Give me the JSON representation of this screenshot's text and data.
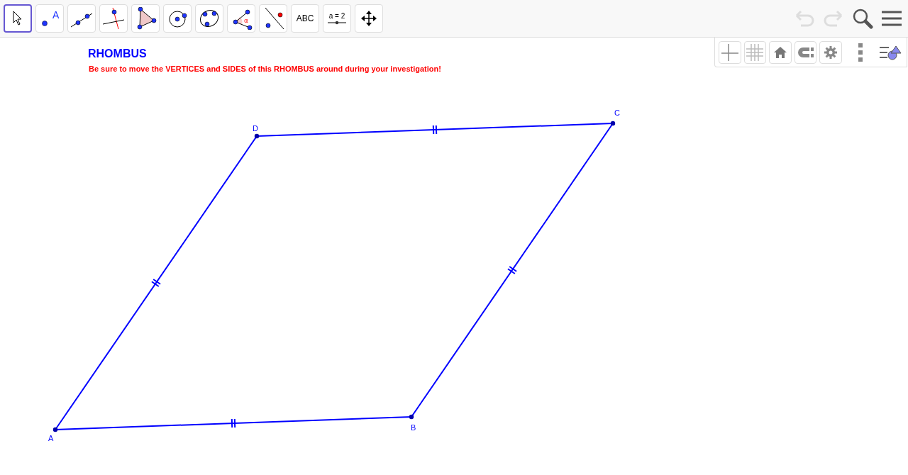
{
  "toolbar": {
    "tools": [
      {
        "kind": "move",
        "selected": true
      },
      {
        "kind": "point",
        "label": "A",
        "selected": false
      },
      {
        "kind": "line",
        "selected": false
      },
      {
        "kind": "perpendicular",
        "selected": false
      },
      {
        "kind": "polygon",
        "selected": false
      },
      {
        "kind": "circle",
        "selected": false
      },
      {
        "kind": "conic",
        "selected": false
      },
      {
        "kind": "angle",
        "label": "α",
        "selected": false
      },
      {
        "kind": "reflect",
        "selected": false
      },
      {
        "kind": "text",
        "label": "ABC",
        "selected": false
      },
      {
        "kind": "slider",
        "label": "a = 2",
        "selected": false
      },
      {
        "kind": "pan",
        "selected": false
      }
    ],
    "undo": {
      "disabled": true
    },
    "redo": {
      "disabled": true
    }
  },
  "style_bar": {
    "buttons": [
      {
        "kind": "axes",
        "selected": false
      },
      {
        "kind": "grid",
        "selected": false
      },
      {
        "kind": "home",
        "selected": false
      },
      {
        "kind": "snap",
        "selected": false
      },
      {
        "kind": "settings",
        "selected": false
      }
    ]
  },
  "canvas": {
    "title": "RHOMBUS",
    "instruction": "Be sure to move the VERTICES and SIDES of this RHOMBUS around during your investigation!",
    "points": [
      {
        "label": "A"
      },
      {
        "label": "B"
      },
      {
        "label": "C"
      },
      {
        "label": "D"
      }
    ]
  }
}
